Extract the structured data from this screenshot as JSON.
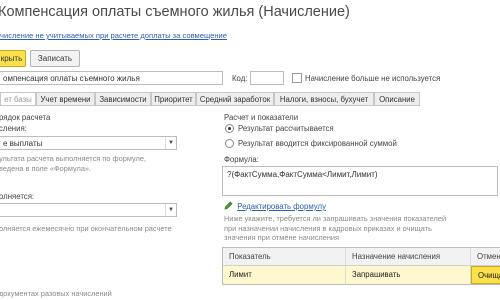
{
  "window": {
    "title": "Компенсация оплаты съемного жилья (Начисление)"
  },
  "hint_link": "числение не учитываемых при расчете доплаты за совмещение",
  "toolbar": {
    "save_close_label": "крыть",
    "save_label": "Записать"
  },
  "header": {
    "name_value": "омпенсация оплаты съемного жилья",
    "code_label": "Код:",
    "code_value": "",
    "not_used_label": "Начисление больше не используется",
    "not_used_checked": false
  },
  "tabs": [
    {
      "label": "ет базы",
      "active": true
    },
    {
      "label": "Учет времени",
      "active": false
    },
    {
      "label": "Зависимости",
      "active": false
    },
    {
      "label": "Приоритет",
      "active": false
    },
    {
      "label": "Средний заработок",
      "active": false
    },
    {
      "label": "Налоги, взносы, бухучет",
      "active": false
    },
    {
      "label": "Описание",
      "active": false
    }
  ],
  "left": {
    "section_title": "рядок расчета",
    "calc_label": "сления:",
    "calc_value": "е выплаты",
    "calc_hint_1": "ультата расчета выполняется по формуле,",
    "calc_hint_2": "ведена в поле «Формула».",
    "executed_label": "олняется:",
    "executed_value": "",
    "executed_hint": "олняется ежемесячно при окончательном расчете",
    "bottom_hint": "документах разовых начислений"
  },
  "right": {
    "section_title": "Расчет и показатели",
    "radio_calculated": "Результат рассчитывается",
    "radio_fixed": "Результат вводится фиксированной суммой",
    "radio_selected": "calculated",
    "formula_label": "Формула:",
    "formula_value": "?(ФактСумма,ФактСумма<Лимит,Лимит)",
    "edit_formula_link": "Редактировать формулу",
    "indicators_hint": "Ниже укажите, требуется ли запрашивать значения показателей при назначении начисления в кадровых приказах и очищать значения при отмене начисления",
    "table": {
      "columns": [
        "Показатель",
        "Назначение начисления",
        "Отмена"
      ],
      "rows": [
        [
          "Лимит",
          "Запрашивать",
          "Очища"
        ]
      ]
    }
  },
  "colors": {
    "accent": "#fbe04c",
    "link": "#2d5fb0"
  }
}
